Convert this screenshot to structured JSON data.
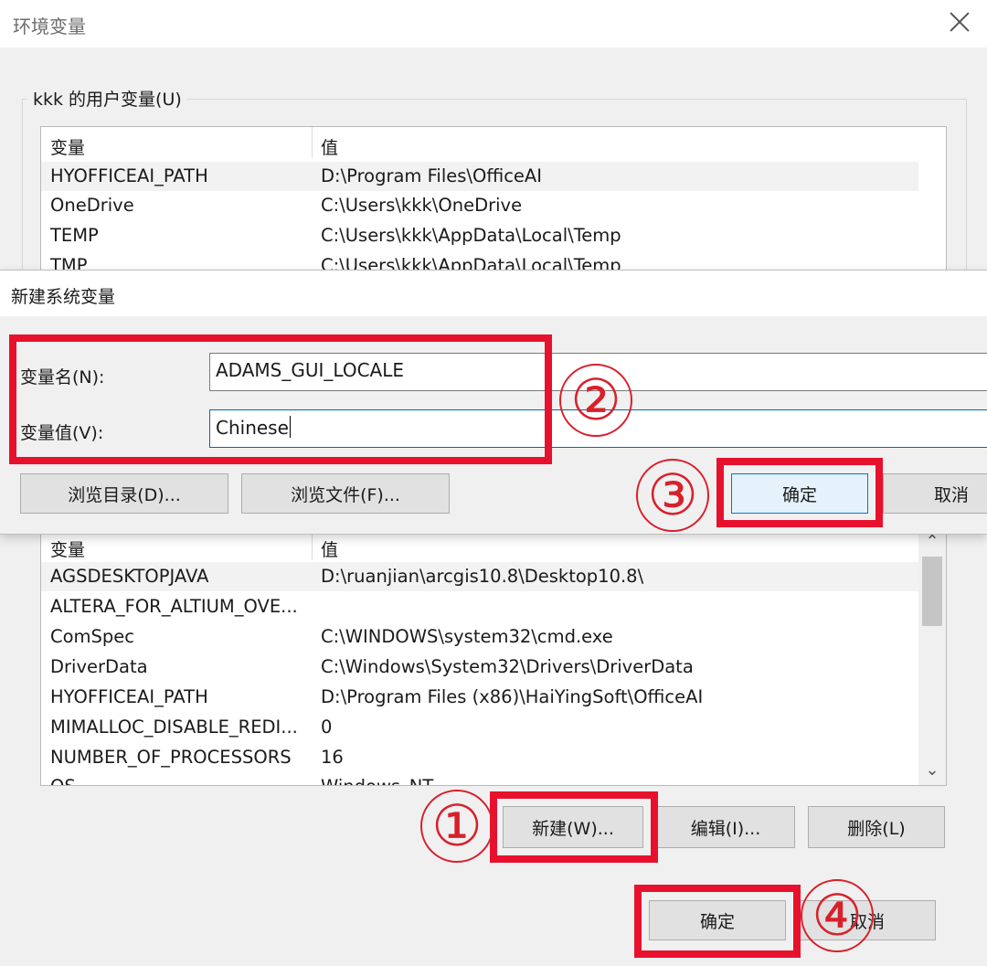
{
  "outer_window": {
    "title": "环境变量",
    "user_group_label": "kkk 的用户变量(U)",
    "user_list": {
      "header": {
        "col_name": "变量",
        "col_value": "值"
      },
      "rows": [
        {
          "name": "HYOFFICEAI_PATH",
          "value": "D:\\Program Files\\OfficeAI"
        },
        {
          "name": "OneDrive",
          "value": "C:\\Users\\kkk\\OneDrive"
        },
        {
          "name": "TEMP",
          "value": "C:\\Users\\kkk\\AppData\\Local\\Temp"
        },
        {
          "name": "TMP",
          "value": "C:\\Users\\kkk\\AppData\\Local\\Temp"
        }
      ]
    },
    "sys_list": {
      "header": {
        "col_name": "变量",
        "col_value": "值"
      },
      "rows": [
        {
          "name": "AGSDESKTOPJAVA",
          "value": "D:\\ruanjian\\arcgis10.8\\Desktop10.8\\"
        },
        {
          "name": "ALTERA_FOR_ALTIUM_OVE...",
          "value": ""
        },
        {
          "name": "ComSpec",
          "value": "C:\\WINDOWS\\system32\\cmd.exe"
        },
        {
          "name": "DriverData",
          "value": "C:\\Windows\\System32\\Drivers\\DriverData"
        },
        {
          "name": "HYOFFICEAI_PATH",
          "value": "D:\\Program Files (x86)\\HaiYingSoft\\OfficeAI"
        },
        {
          "name": "MIMALLOC_DISABLE_REDI...",
          "value": "0"
        },
        {
          "name": "NUMBER_OF_PROCESSORS",
          "value": "16"
        },
        {
          "name": "OS",
          "value": "Windows_NT"
        }
      ]
    },
    "sys_buttons": {
      "new": "新建(W)...",
      "edit": "编辑(I)...",
      "delete": "删除(L)"
    },
    "footer_buttons": {
      "ok": "确定",
      "cancel": "取消"
    }
  },
  "new_var_dialog": {
    "title": "新建系统变量",
    "name_label": "变量名(N):",
    "name_value": "ADAMS_GUI_LOCALE",
    "value_label": "变量值(V):",
    "value_value": "Chinese",
    "browse_dir": "浏览目录(D)...",
    "browse_file": "浏览文件(F)...",
    "ok": "确定",
    "cancel": "取消"
  },
  "annotations": {
    "step1": "①",
    "step2": "②",
    "step3": "③",
    "step4": "④"
  },
  "colors": {
    "annotation_red": "#e8112d",
    "focus_blue": "#0078d7"
  }
}
